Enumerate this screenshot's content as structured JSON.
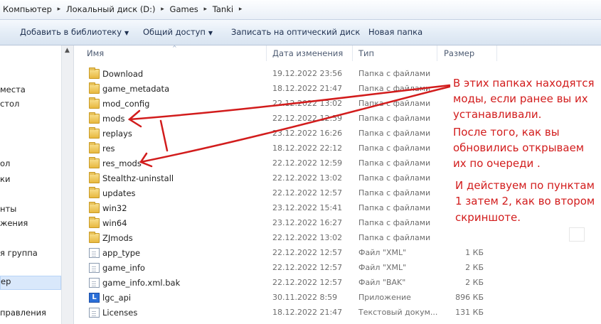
{
  "breadcrumb": [
    "Компьютер",
    "Локальный диск (D:)",
    "Games",
    "Tanki"
  ],
  "toolbar": {
    "add_library": "Добавить в библиотеку",
    "share": "Общий доступ",
    "burn": "Записать на оптический диск",
    "new_folder": "Новая папка"
  },
  "nav": [
    "места",
    "стол",
    "ол",
    "ки",
    "нты",
    "жения",
    "я группа",
    "ер",
    "правления"
  ],
  "columns": {
    "name": "Имя",
    "date": "Дата изменения",
    "type": "Тип",
    "size": "Размер"
  },
  "files": [
    {
      "name": "Download",
      "date": "19.12.2022 23:56",
      "type": "Папка с файлами",
      "size": "",
      "icon": "folder"
    },
    {
      "name": "game_metadata",
      "date": "18.12.2022 21:47",
      "type": "Папка с файлами",
      "size": "",
      "icon": "folder"
    },
    {
      "name": "mod_config",
      "date": "22.12.2022 13:02",
      "type": "Папка с файлами",
      "size": "",
      "icon": "folder"
    },
    {
      "name": "mods",
      "date": "22.12.2022 12:59",
      "type": "Папка с файлами",
      "size": "",
      "icon": "folder"
    },
    {
      "name": "replays",
      "date": "23.12.2022 16:26",
      "type": "Папка с файлами",
      "size": "",
      "icon": "folder"
    },
    {
      "name": "res",
      "date": "18.12.2022 22:12",
      "type": "Папка с файлами",
      "size": "",
      "icon": "folder"
    },
    {
      "name": "res_mods",
      "date": "22.12.2022 12:59",
      "type": "Папка с файлами",
      "size": "",
      "icon": "folder"
    },
    {
      "name": "Stealthz-uninstall",
      "date": "22.12.2022 13:02",
      "type": "Папка с файлами",
      "size": "",
      "icon": "folder"
    },
    {
      "name": "updates",
      "date": "22.12.2022 12:57",
      "type": "Папка с файлами",
      "size": "",
      "icon": "folder"
    },
    {
      "name": "win32",
      "date": "23.12.2022 15:41",
      "type": "Папка с файлами",
      "size": "",
      "icon": "folder"
    },
    {
      "name": "win64",
      "date": "23.12.2022 16:27",
      "type": "Папка с файлами",
      "size": "",
      "icon": "folder"
    },
    {
      "name": "ZJmods",
      "date": "22.12.2022 13:02",
      "type": "Папка с файлами",
      "size": "",
      "icon": "folder"
    },
    {
      "name": "app_type",
      "date": "22.12.2022 12:57",
      "type": "Файл \"XML\"",
      "size": "1 КБ",
      "icon": "doc"
    },
    {
      "name": "game_info",
      "date": "22.12.2022 12:57",
      "type": "Файл \"XML\"",
      "size": "2 КБ",
      "icon": "doc"
    },
    {
      "name": "game_info.xml.bak",
      "date": "22.12.2022 12:57",
      "type": "Файл \"BAK\"",
      "size": "2 КБ",
      "icon": "doc"
    },
    {
      "name": "lgc_api",
      "date": "30.11.2022 8:59",
      "type": "Приложение",
      "size": "896 КБ",
      "icon": "app"
    },
    {
      "name": "Licenses",
      "date": "18.12.2022 21:47",
      "type": "Текстовый докум...",
      "size": "131 КБ",
      "icon": "doc"
    }
  ],
  "annotation": {
    "lines": [
      "В этих папках находятся",
      "моды, если ранее вы их",
      "устанавливали.",
      "После того, как вы",
      "обновились открываем",
      "их по очереди .",
      "И действуем по пунктам",
      "1 затем 2, как во втором",
      "скриншоте."
    ],
    "color": "#d21c1c"
  }
}
